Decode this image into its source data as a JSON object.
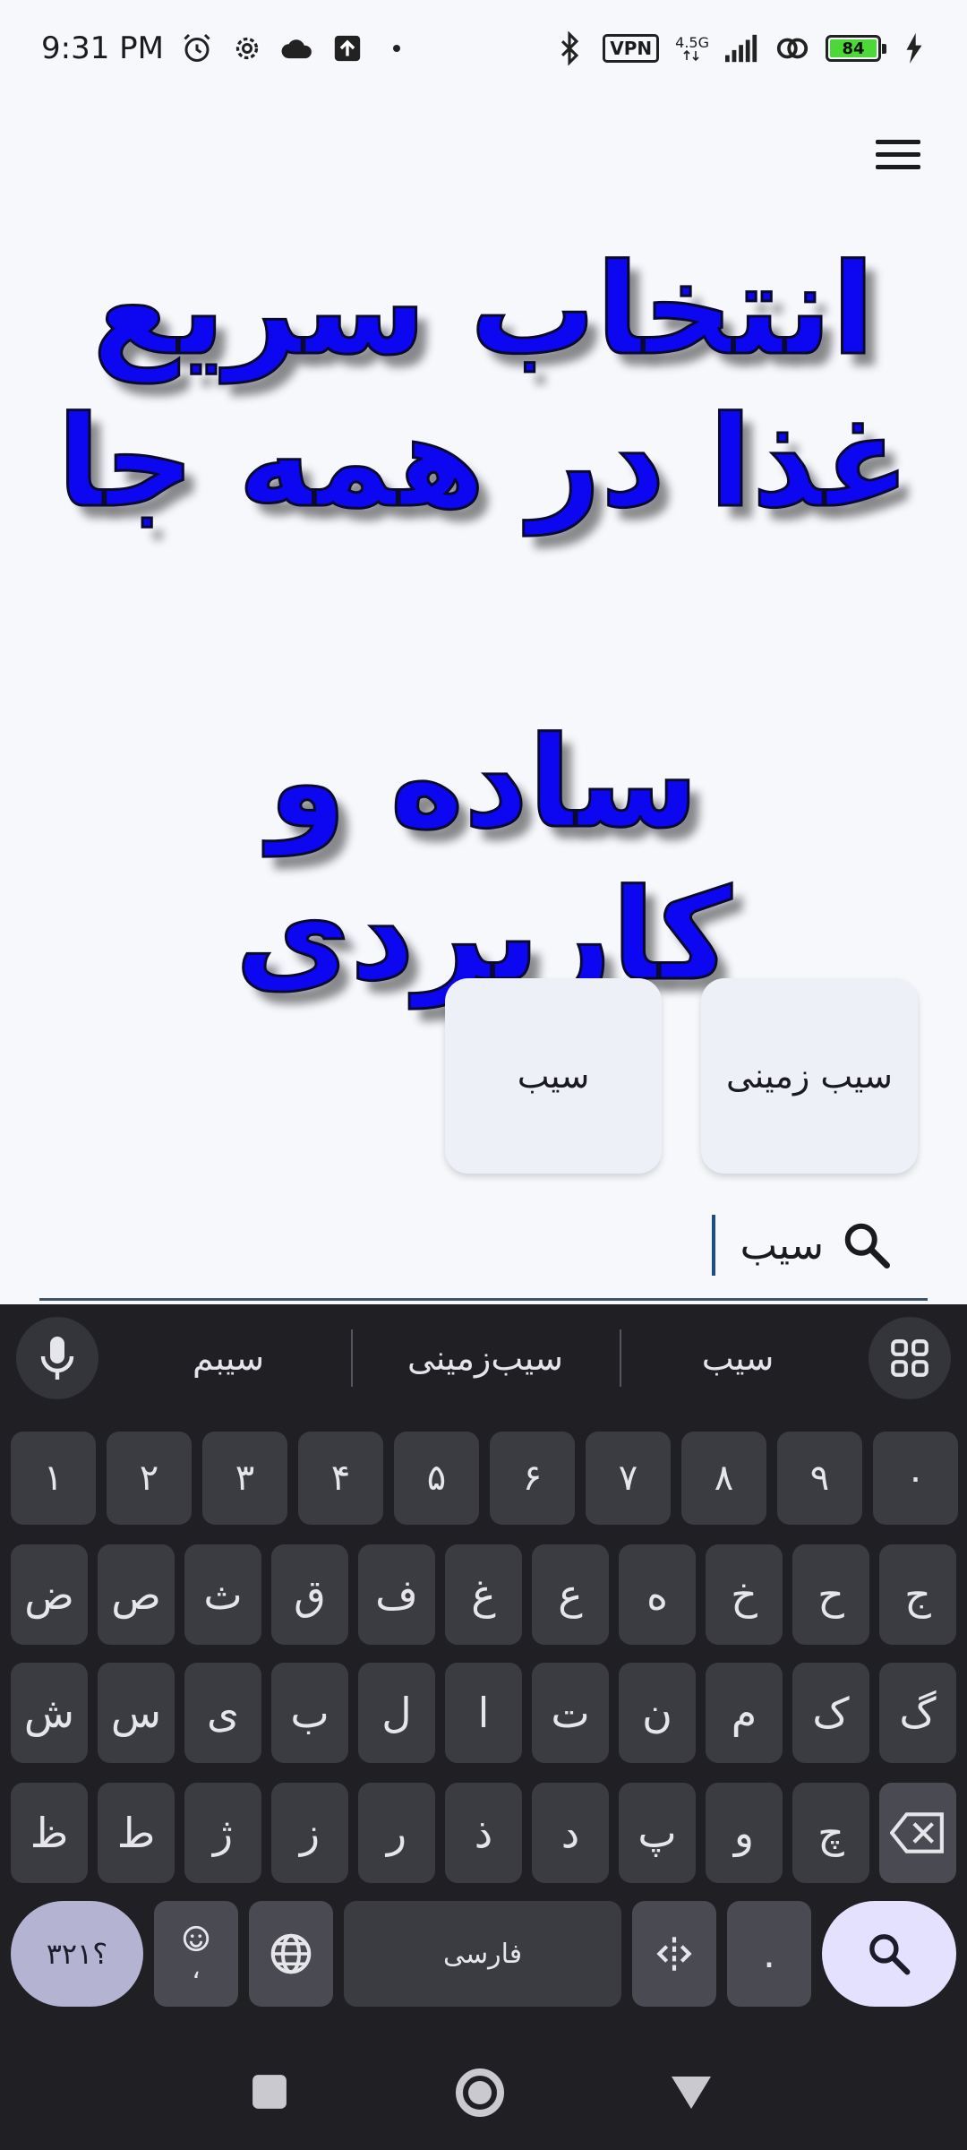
{
  "status_bar": {
    "time": "9:31 PM",
    "icons_left": [
      "alarm-icon",
      "settings-icon",
      "cloud-icon",
      "upload-icon"
    ],
    "vpn": "VPN",
    "network": "4.5G",
    "battery": "84"
  },
  "headline": {
    "line1": "انتخاب سریع",
    "line2": "غذا در همه جا",
    "line3": "ساده و کاربردی"
  },
  "cards": [
    "سیب زمینی",
    "سیب"
  ],
  "search": {
    "value": "سیب",
    "icon": "search-icon"
  },
  "keyboard": {
    "suggestions": [
      "سیب",
      "سیب‌زمینی",
      "سیبم"
    ],
    "digits": [
      "۰",
      "۹",
      "۸",
      "۷",
      "۶",
      "۵",
      "۴",
      "۳",
      "۲",
      "۱"
    ],
    "row1": [
      "ج",
      "ح",
      "خ",
      "ه",
      "ع",
      "غ",
      "ف",
      "ق",
      "ث",
      "ص",
      "ض"
    ],
    "row2": [
      "گ",
      "ک",
      "م",
      "ن",
      "ت",
      "ا",
      "ل",
      "ب",
      "ی",
      "س",
      "ش"
    ],
    "row3": [
      "چ",
      "و",
      "پ",
      "د",
      "ذ",
      "ر",
      "ز",
      "ژ",
      "ط",
      "ظ"
    ],
    "symbols": "؟۳۲۱",
    "comma": "،",
    "space": "فارسی",
    "period": "."
  }
}
